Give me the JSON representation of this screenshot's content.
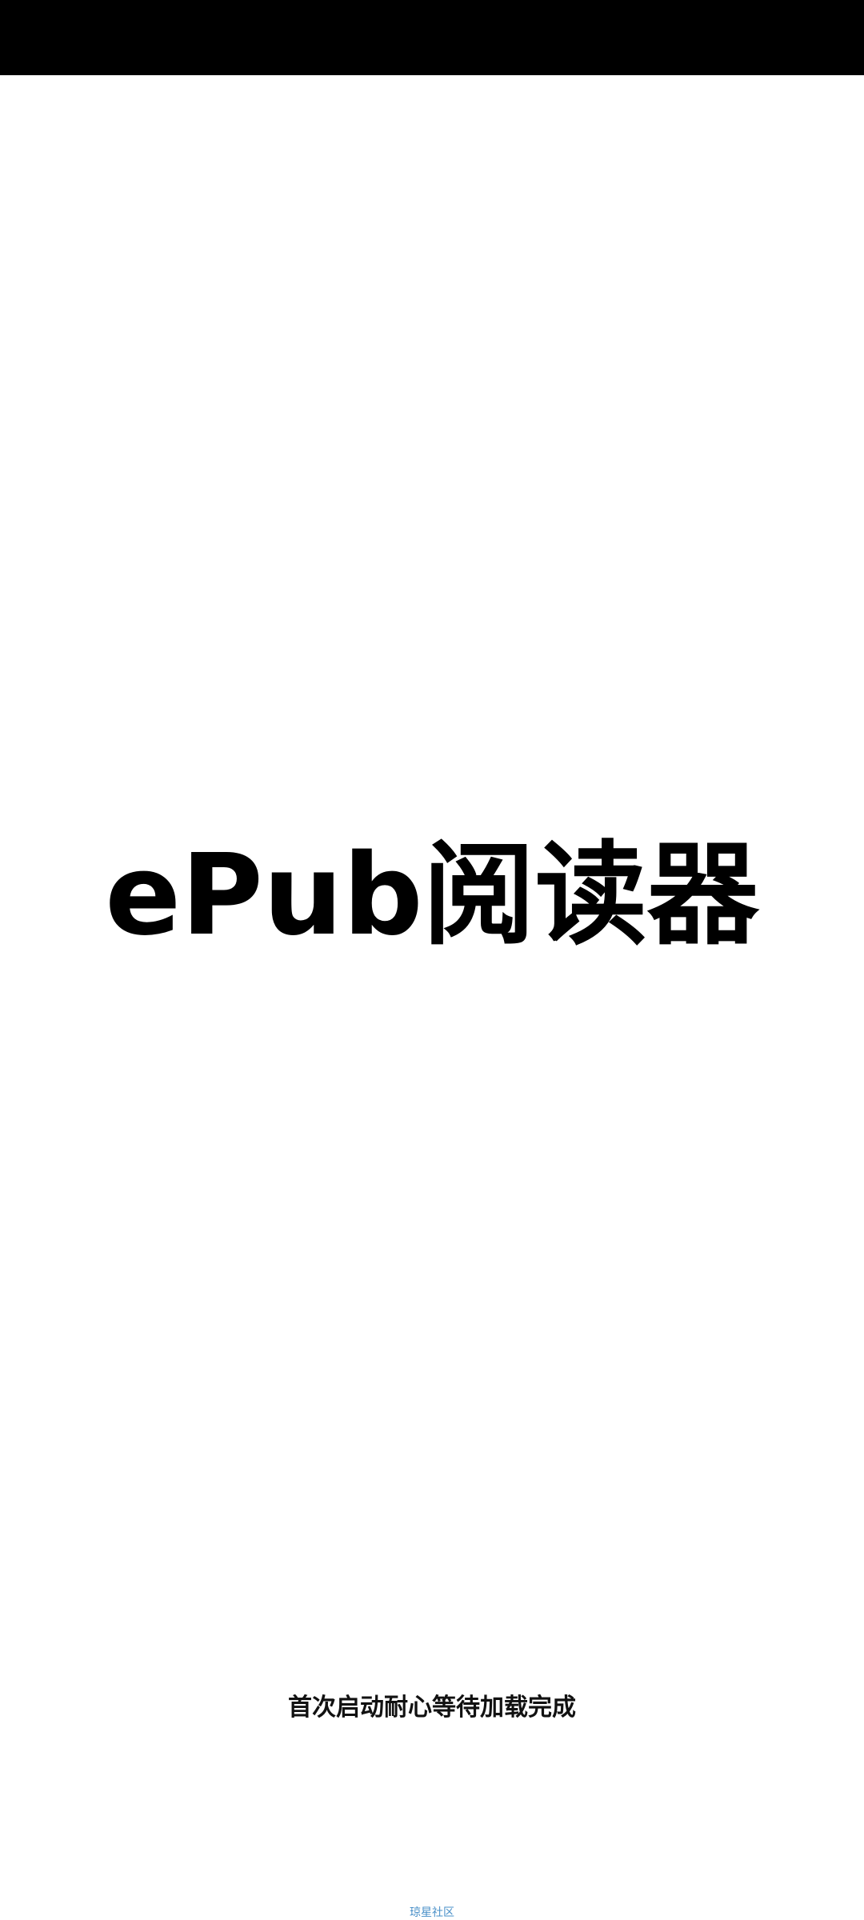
{
  "splash": {
    "title": "ePub阅读器",
    "loading_hint": "首次启动耐心等待加载完成",
    "community_link": "琼星社区"
  },
  "colors": {
    "status_bar": "#000000",
    "background": "#ffffff",
    "title": "#000000",
    "link": "#4a90c8"
  }
}
